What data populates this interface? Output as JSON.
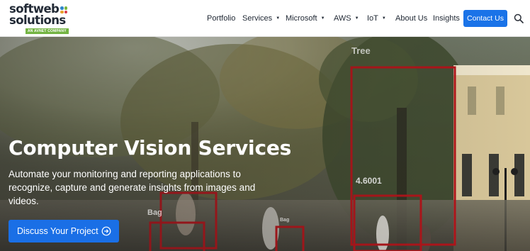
{
  "brand": {
    "logo_line1": "softweb",
    "logo_line2": "solutions",
    "logo_tagline": "AN AVNET COMPANY",
    "dot_colors": [
      "#2f86c9",
      "#7cb440",
      "#e8a02a",
      "#d93b48"
    ]
  },
  "nav": {
    "items": [
      {
        "label": "Portfolio",
        "dropdown": false
      },
      {
        "label": "Services",
        "dropdown": true
      },
      {
        "label": "Microsoft",
        "dropdown": true
      },
      {
        "label": "AWS",
        "dropdown": true
      },
      {
        "label": "IoT",
        "dropdown": true
      },
      {
        "label": "About Us",
        "dropdown": false
      },
      {
        "label": "Insights",
        "dropdown": false
      }
    ],
    "contact_label": "Contact Us",
    "search_icon": "search-icon"
  },
  "hero": {
    "title": "Computer Vision Services",
    "description": "Automate your monitoring and reporting applications to recognize, capture and generate insights from images and videos.",
    "cta_label": "Discuss Your Project",
    "cta_icon": "arrow-circle-right-icon",
    "detections": {
      "tree_label": "Tree",
      "tree_score": "4.6001",
      "bag_label": "Bag",
      "bag_label_small": "Bag"
    },
    "box_color": "#b3141a"
  },
  "colors": {
    "accent": "#1a73e8",
    "text_dark": "#1f2733",
    "logo_tag_green": "#74b443"
  }
}
